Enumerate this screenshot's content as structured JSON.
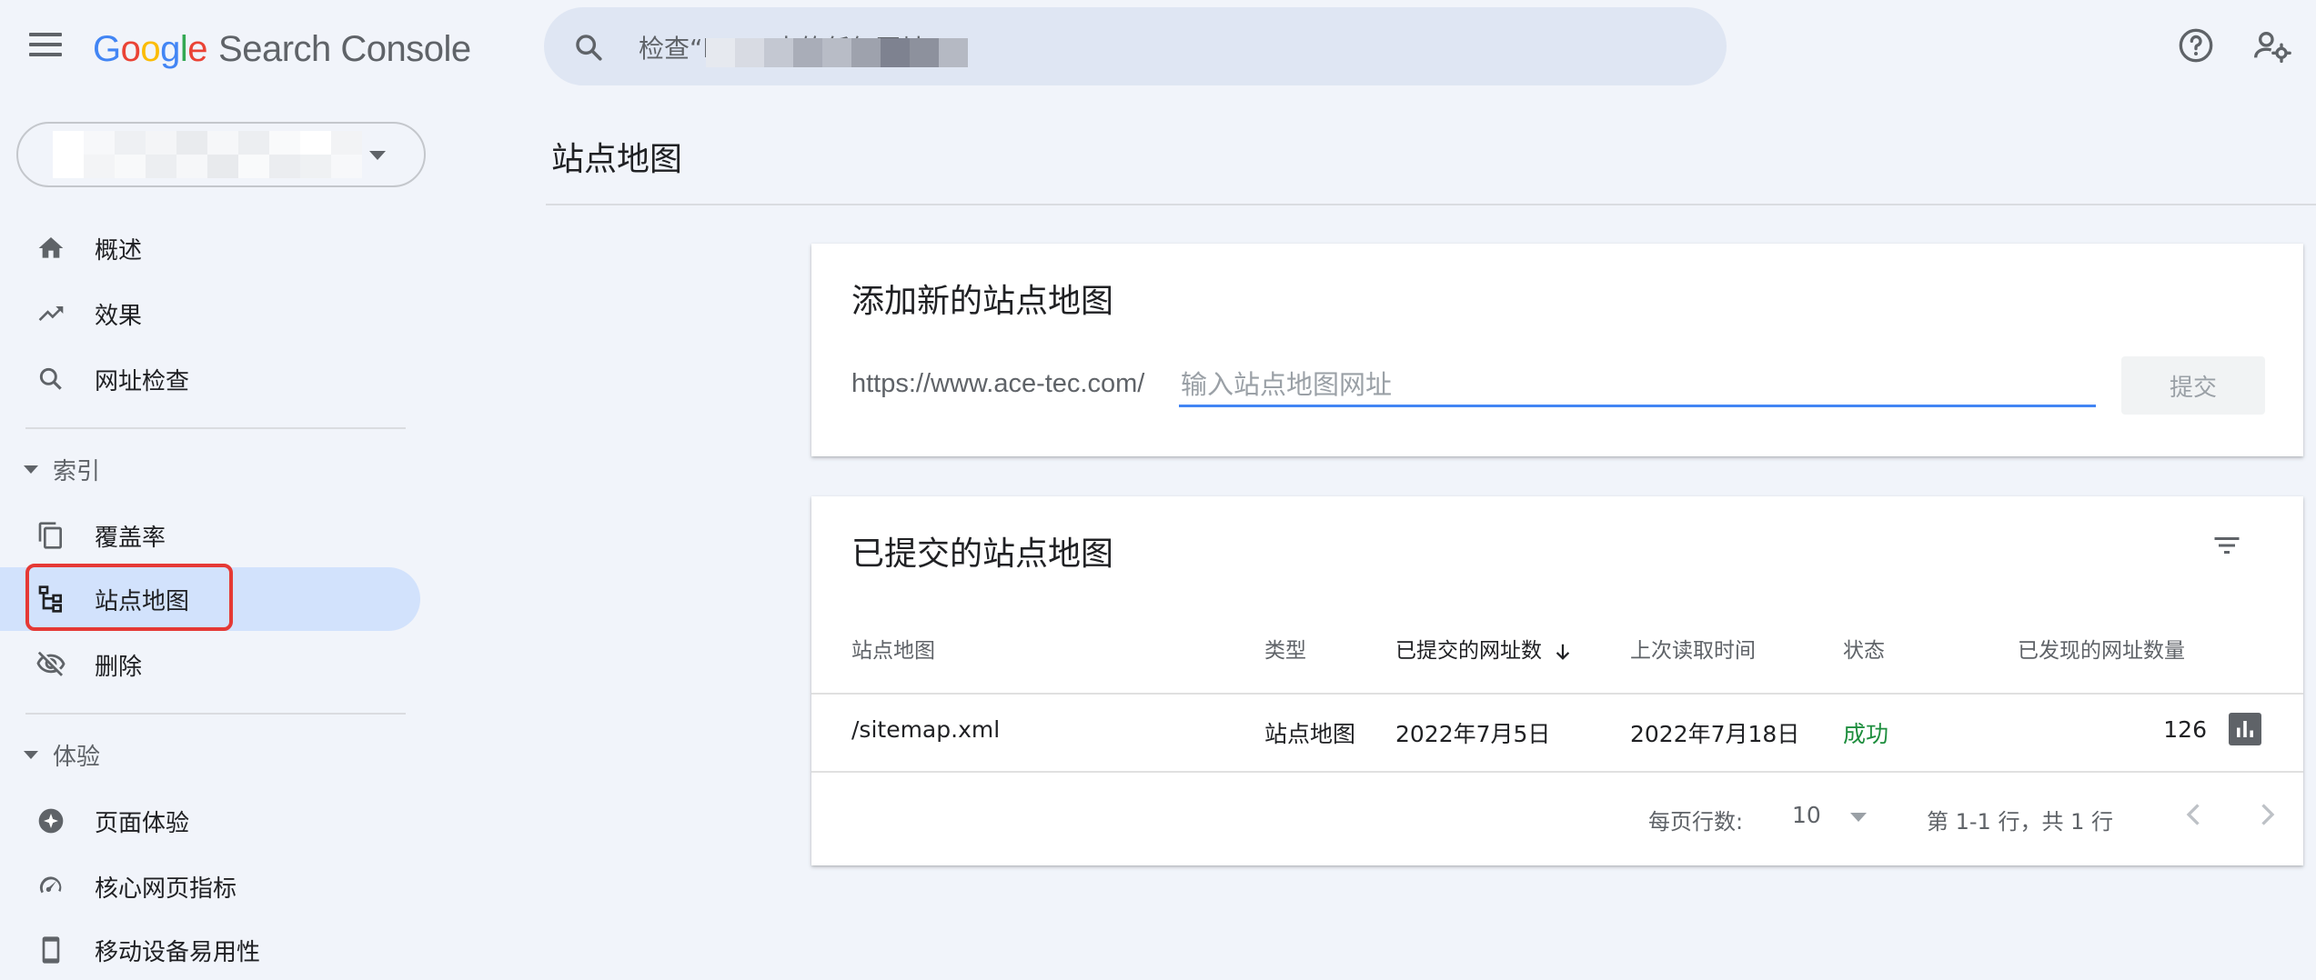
{
  "header": {
    "logo_letters": [
      "G",
      "o",
      "o",
      "g",
      "l",
      "e"
    ],
    "product": "Search Console",
    "search": {
      "text": "检查“h                            m/”中的任何网址"
    },
    "icons": [
      "menu-icon",
      "search-icon",
      "help-icon",
      "manage-users-icon"
    ]
  },
  "property_selector": {
    "value": ""
  },
  "sidebar": {
    "items_top": [
      {
        "label": "概述",
        "icon": "home-icon"
      },
      {
        "label": "效果",
        "icon": "trending-up-icon"
      },
      {
        "label": "网址检查",
        "icon": "search-icon"
      }
    ],
    "index_section": {
      "label": "索引"
    },
    "index_items": [
      {
        "label": "覆盖率",
        "icon": "file-copy-icon"
      },
      {
        "label": "站点地图",
        "icon": "sitemap-icon",
        "active": true
      },
      {
        "label": "删除",
        "icon": "visibility-off-icon"
      }
    ],
    "experience_section": {
      "label": "体验"
    },
    "experience_items": [
      {
        "label": "页面体验",
        "icon": "add-circle-icon"
      },
      {
        "label": "核心网页指标",
        "icon": "speed-gauge-icon"
      },
      {
        "label": "移动设备易用性",
        "icon": "smartphone-icon"
      }
    ]
  },
  "main": {
    "page_title": "站点地图",
    "add_card": {
      "title": "添加新的站点地图",
      "prefix": "https://www.ace-tec.com/",
      "input_value": "",
      "input_placeholder": "输入站点地图网址",
      "submit_label": "提交"
    },
    "submitted_card": {
      "title": "已提交的站点地图",
      "columns": [
        "站点地图",
        "类型",
        "已提交的网址数",
        "上次读取时间",
        "状态",
        "已发现的网址数量"
      ],
      "sorted_column": "已提交的网址数",
      "rows": [
        {
          "sitemap": "/sitemap.xml",
          "type": "站点地图",
          "submitted": "2022年7月5日",
          "last_read": "2022年7月18日",
          "status": "成功",
          "discovered": "126"
        }
      ],
      "pagination": {
        "rows_per_page_label": "每页行数:",
        "rows_per_page": "10",
        "range": "第 1-1 行，共 1 行"
      }
    }
  },
  "colors": {
    "background": "#f1f4fa",
    "search_bg": "#dfe6f3",
    "active_nav": "#d2e2fc",
    "accent_blue": "#4285f4",
    "success_green": "#1e8e3e",
    "highlight_red": "#e53935"
  }
}
